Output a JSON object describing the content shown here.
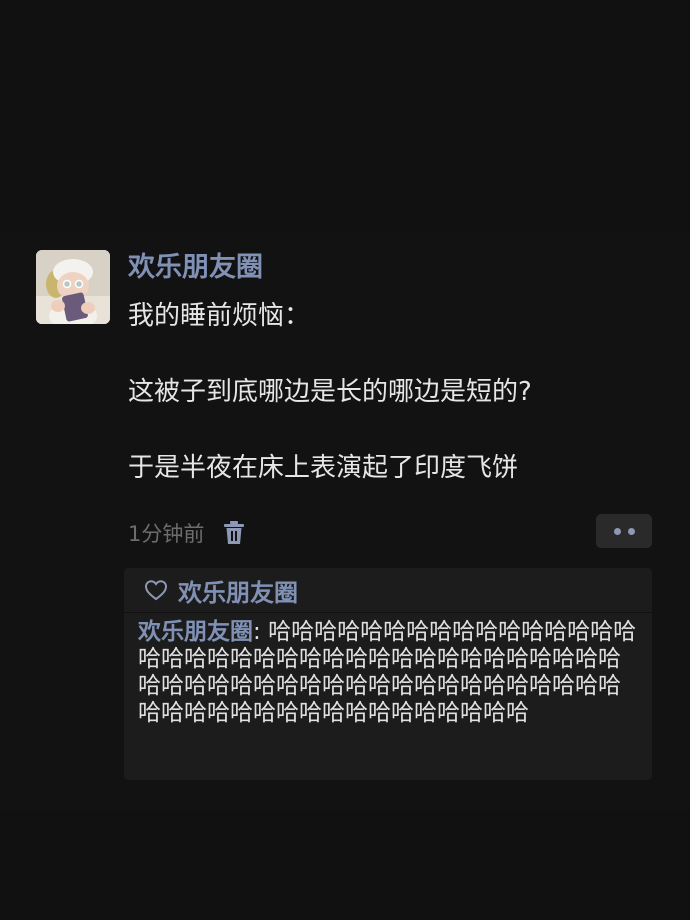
{
  "post": {
    "username": "欢乐朋友圈",
    "content_lines": [
      "我的睡前烦恼：",
      "这被子到底哪边是长的哪边是短的?",
      "于是半夜在床上表演起了印度飞饼"
    ],
    "time": "1分钟前",
    "icons": {
      "delete": "trash-icon",
      "more": "more-dots-icon",
      "like": "heart-icon"
    }
  },
  "interactions": {
    "likes": [
      "欢乐朋友圈"
    ],
    "comments": [
      {
        "author": "欢乐朋友圈",
        "separator": ": ",
        "text": "哈哈哈哈哈哈哈哈哈哈哈哈哈哈哈哈哈哈哈哈哈哈哈哈哈哈哈哈哈哈哈哈哈哈哈哈哈哈哈哈哈哈哈哈哈哈哈哈哈哈哈哈哈哈哈哈哈哈哈哈哈哈哈哈哈哈哈哈哈哈哈哈哈哈哈"
      }
    ]
  },
  "colors": {
    "background": "#111111",
    "name_link": "#8091b5",
    "text": "#e6e6e6",
    "meta": "#6d6d6d",
    "panel": "#1c1c1c"
  }
}
